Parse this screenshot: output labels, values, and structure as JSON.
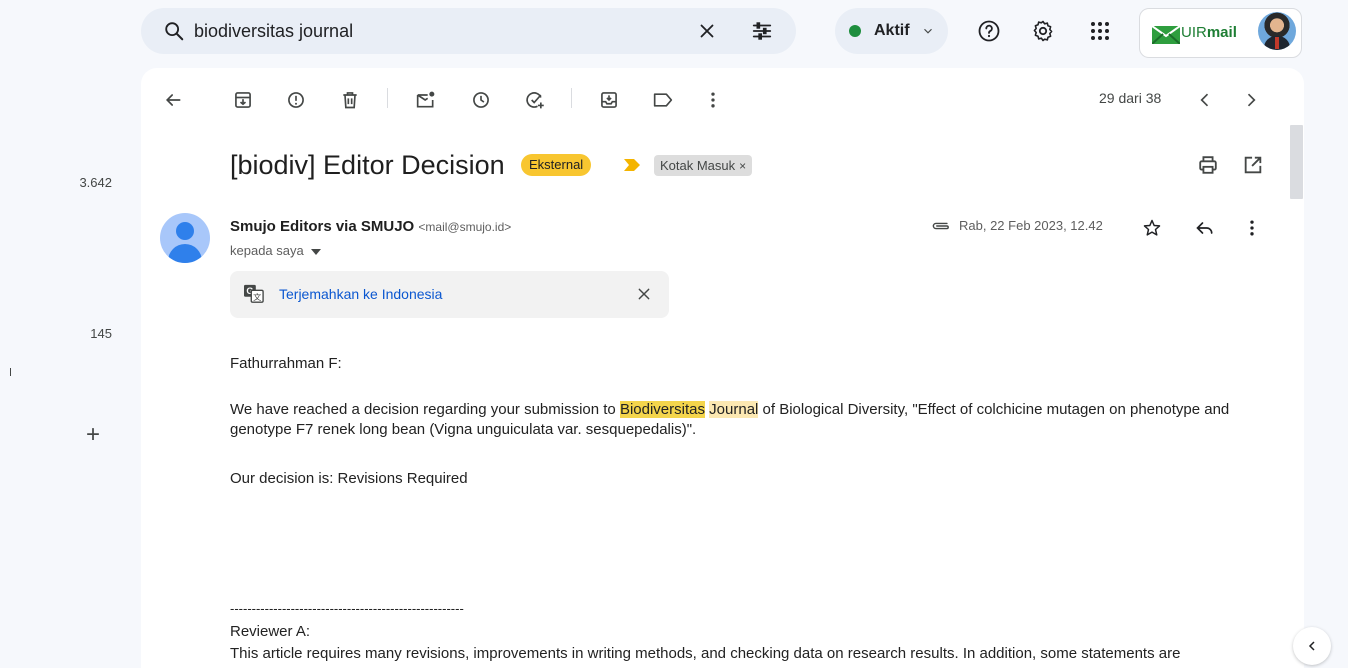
{
  "left_rail": {
    "count_1": "3.642",
    "count_2": "145",
    "add_icon": "plus-icon"
  },
  "search": {
    "value": "biodiversitas journal",
    "icons": [
      "search-icon",
      "close-icon",
      "tune-icon"
    ]
  },
  "status": {
    "label": "Aktif",
    "color": "#1e8e3e"
  },
  "top_icons": [
    "help-icon",
    "settings-icon",
    "apps-icon"
  ],
  "brand": {
    "prefix": "UIR",
    "suffix": "mail",
    "color": "#1e7e34"
  },
  "toolbar": {
    "icons": [
      "back-arrow-icon",
      "archive-icon",
      "report-spam-icon",
      "delete-icon",
      "mark-unread-icon",
      "snooze-icon",
      "add-task-icon",
      "move-to-icon",
      "label-icon",
      "more-vert-icon"
    ],
    "pager_text": "29 dari 38"
  },
  "email": {
    "subject": "[biodiv] Editor Decision",
    "label_external": "Eksternal",
    "label_inbox": "Kotak Masuk",
    "label_inbox_close": "×",
    "sender_name": "Smujo Editors via SMUJO",
    "sender_addr": "<mail@smujo.id>",
    "to_line": "kepada saya",
    "date": "Rab, 22 Feb 2023, 12.42",
    "translate_link": "Terjemahkan ke Indonesia"
  },
  "body": {
    "greeting": "Fathurrahman F:",
    "p1_before": "We have reached a decision regarding your submission to ",
    "p1_hl1": "Biodiversitas",
    "p1_space": " ",
    "p1_hl2": "Journal",
    "p1_after": " of Biological Diversity, \"Effect of colchicine mutagen on phenotype and genotype F7 renek long bean (Vigna unguiculata var. sesquepedalis)\".",
    "decision": "Our decision is: Revisions Required",
    "separator": "------------------------------------------------------",
    "reviewer": "Reviewer A:",
    "reviewer_text": "This article requires many revisions, improvements in writing methods, and checking data on research results. In addition, some statements are"
  },
  "colors": {
    "label_external": "#f8c630",
    "highlight": "#fce8b2",
    "link": "#0b57d0"
  }
}
